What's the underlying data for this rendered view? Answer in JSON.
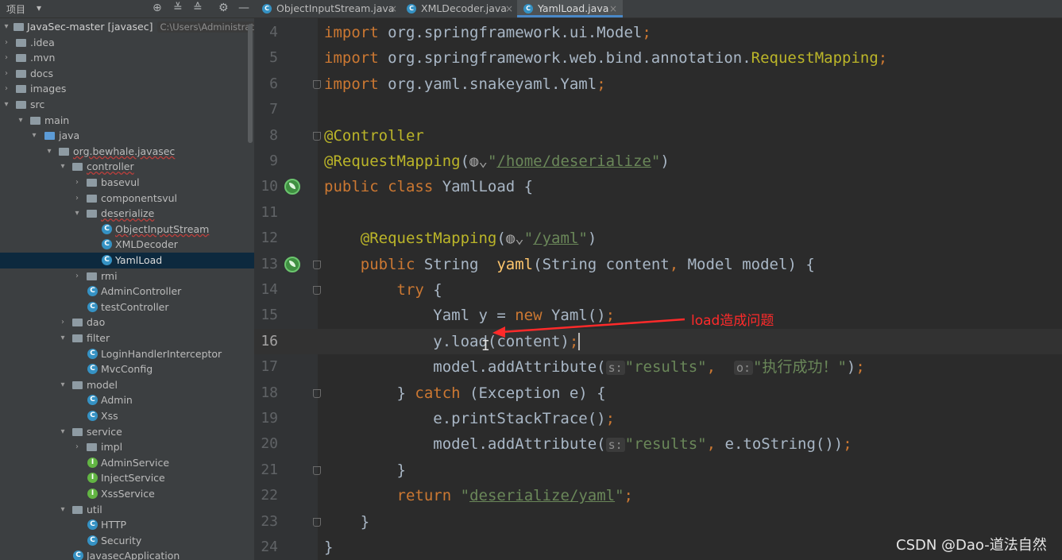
{
  "sidebar": {
    "title": "项目",
    "root": {
      "label": "JavaSec-master [javasec]",
      "path": "C:\\Users\\Administrator\\Des"
    },
    "items": [
      {
        "label": ".idea",
        "type": "folder"
      },
      {
        "label": ".mvn",
        "type": "folder"
      },
      {
        "label": "docs",
        "type": "folder"
      },
      {
        "label": "images",
        "type": "folder"
      },
      {
        "label": "src",
        "type": "folder"
      },
      {
        "label": "main",
        "type": "folder"
      },
      {
        "label": "java",
        "type": "folder"
      },
      {
        "label": "org.bewhale.javasec",
        "type": "package"
      },
      {
        "label": "controller",
        "type": "package"
      },
      {
        "label": "basevul",
        "type": "package"
      },
      {
        "label": "componentsvul",
        "type": "package"
      },
      {
        "label": "deserialize",
        "type": "package"
      },
      {
        "label": "ObjectInputStream",
        "type": "class"
      },
      {
        "label": "XMLDecoder",
        "type": "class"
      },
      {
        "label": "YamlLoad",
        "type": "class"
      },
      {
        "label": "rmi",
        "type": "package"
      },
      {
        "label": "AdminController",
        "type": "class"
      },
      {
        "label": "testController",
        "type": "class"
      },
      {
        "label": "dao",
        "type": "package"
      },
      {
        "label": "filter",
        "type": "package"
      },
      {
        "label": "LoginHandlerInterceptor",
        "type": "class"
      },
      {
        "label": "MvcConfig",
        "type": "class"
      },
      {
        "label": "model",
        "type": "package"
      },
      {
        "label": "Admin",
        "type": "class"
      },
      {
        "label": "Xss",
        "type": "class"
      },
      {
        "label": "service",
        "type": "package"
      },
      {
        "label": "impl",
        "type": "package"
      },
      {
        "label": "AdminService",
        "type": "interface"
      },
      {
        "label": "InjectService",
        "type": "interface"
      },
      {
        "label": "XssService",
        "type": "interface"
      },
      {
        "label": "util",
        "type": "package"
      },
      {
        "label": "HTTP",
        "type": "class"
      },
      {
        "label": "Security",
        "type": "class"
      },
      {
        "label": "JavasecApplication",
        "type": "class"
      }
    ]
  },
  "tabs": [
    {
      "label": "ObjectInputStream.java",
      "close": "×"
    },
    {
      "label": "XMLDecoder.java",
      "close": "×"
    },
    {
      "label": "YamlLoad.java",
      "close": "×",
      "active": true
    }
  ],
  "editor": {
    "line_numbers": [
      "4",
      "5",
      "6",
      "7",
      "8",
      "9",
      "10",
      "11",
      "12",
      "13",
      "14",
      "15",
      "16",
      "17",
      "18",
      "19",
      "20",
      "21",
      "22",
      "23",
      "24"
    ],
    "current_line": "16",
    "hints": {
      "s": "s:",
      "o": "o:"
    },
    "strings": {
      "path_home": "/home/deserialize",
      "path_yaml": "/yaml",
      "results": "\"results\"",
      "success": "\"执行成功！\"",
      "view": "deserialize/yaml"
    }
  },
  "annotation": {
    "text": "load造成问题"
  },
  "watermark": "CSDN @Dao-道法自然",
  "colors": {
    "keyword": "#cc7832",
    "annotation": "#bbb529",
    "string": "#6a8759",
    "method": "#ffc66d",
    "default": "#a9b7c6",
    "note": "#ff2a2a"
  }
}
